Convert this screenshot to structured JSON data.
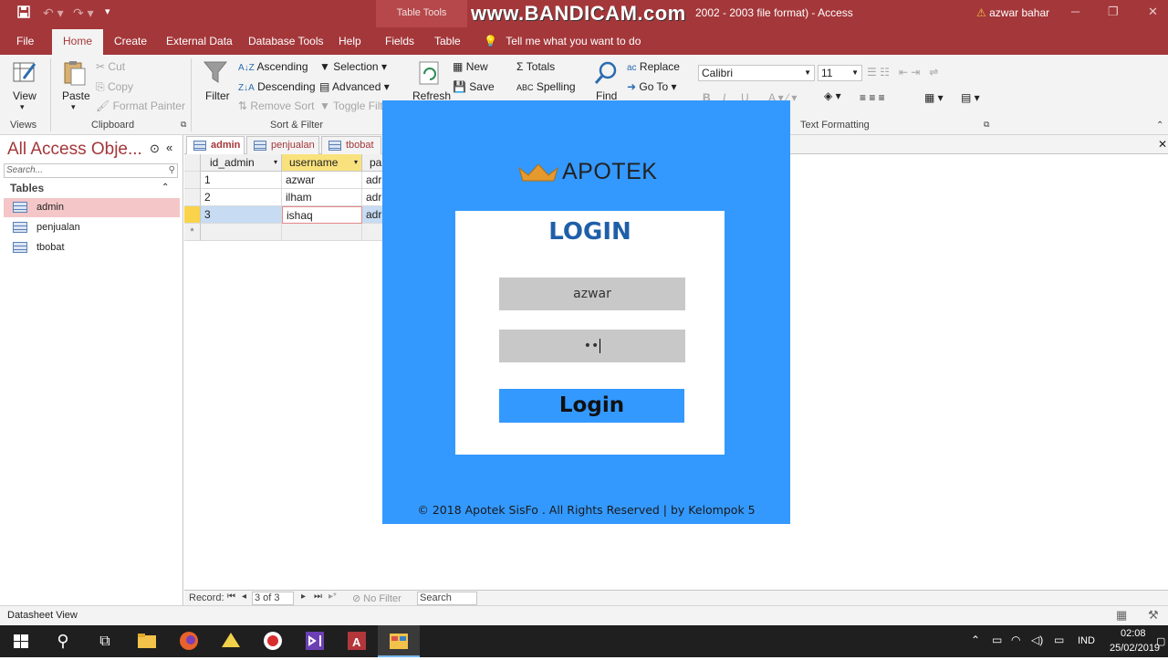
{
  "titlebar": {
    "table_tools": "Table Tools",
    "doc_title": "2002 - 2003 file format)  -  Access",
    "watermark": "www.BANDICAM.com",
    "user": "azwar bahar",
    "warn_icon": "warning-icon"
  },
  "tabs": [
    "File",
    "Home",
    "Create",
    "External Data",
    "Database Tools",
    "Help",
    "Fields",
    "Table"
  ],
  "tell_me": "Tell me what you want to do",
  "ribbon": {
    "view": "View",
    "paste": "Paste",
    "cut": "Cut",
    "copy": "Copy",
    "format_painter": "Format Painter",
    "filter": "Filter",
    "ascending": "Ascending",
    "descending": "Descending",
    "remove_sort": "Remove Sort",
    "selection": "Selection",
    "advanced": "Advanced",
    "toggle_filter": "Toggle Filt",
    "refresh": "Refresh",
    "new": "New",
    "save": "Save",
    "totals": "Totals",
    "spelling": "Spelling",
    "find": "Find",
    "replace": "Replace",
    "goto": "Go To",
    "font": "Calibri",
    "font_size": "11",
    "groups": {
      "views": "Views",
      "clipboard": "Clipboard",
      "sort_filter": "Sort & Filter",
      "text_formatting": "Text Formatting"
    }
  },
  "nav": {
    "title": "All Access Obje...",
    "search_placeholder": "Search...",
    "section": "Tables",
    "items": [
      "admin",
      "penjualan",
      "tbobat"
    ]
  },
  "doctabs": [
    "admin",
    "penjualan",
    "tbobat"
  ],
  "datasheet": {
    "columns": [
      "id_admin",
      "username",
      "pa"
    ],
    "rows": [
      [
        "1",
        "azwar",
        "adr"
      ],
      [
        "2",
        "ilham",
        "adr"
      ],
      [
        "3",
        "ishaq",
        "adr"
      ]
    ],
    "new_row_marker": "*"
  },
  "record_nav": {
    "label": "Record:",
    "position": "3 of 3",
    "filter": "No Filter",
    "search": "Search"
  },
  "status": {
    "view": "Datasheet View"
  },
  "login": {
    "brand": "APOTEK",
    "heading": "LOGIN",
    "username_value": "azwar",
    "password_value": "••",
    "button": "Login",
    "footer": "© 2018 Apotek SisFo . All Rights Reserved | by Kelompok 5"
  },
  "taskbar": {
    "lang": "IND",
    "time": "02:08",
    "date": "25/02/2019"
  }
}
